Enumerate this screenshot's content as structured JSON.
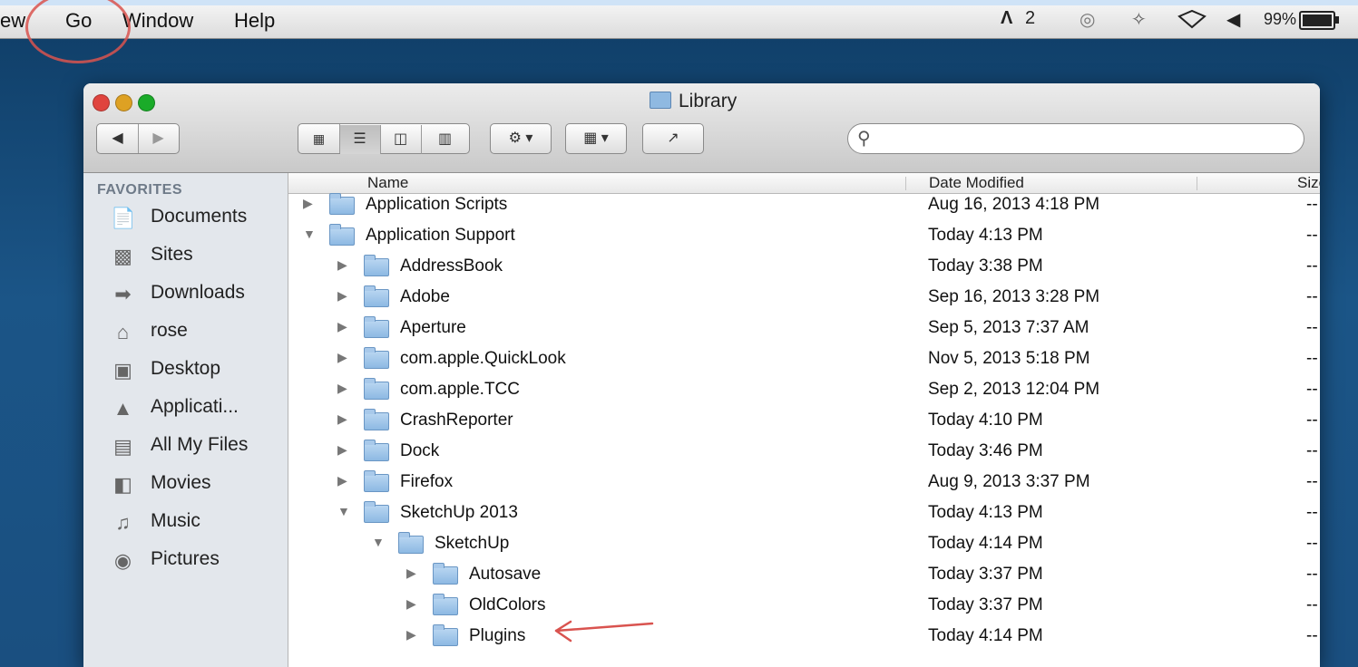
{
  "menubar": {
    "items": [
      "ew",
      "Go",
      "Window",
      "Help"
    ],
    "status": {
      "adobe": "2",
      "battery": "99%",
      "battery_level": 0.99
    },
    "icons": [
      "adobe-icon",
      "sync-icon",
      "bluetooth-icon",
      "wifi-icon",
      "volume-icon",
      "battery-icon"
    ],
    "highlight_color": "#d9534f"
  },
  "window": {
    "title": "Library",
    "search_placeholder": ""
  },
  "sidebar": {
    "heading": "FAVORITES",
    "items": [
      {
        "label": "Documents",
        "icon": "documents-icon"
      },
      {
        "label": "Sites",
        "icon": "folder-icon"
      },
      {
        "label": "Downloads",
        "icon": "downloads-icon"
      },
      {
        "label": "rose",
        "icon": "home-icon"
      },
      {
        "label": "Desktop",
        "icon": "desktop-icon"
      },
      {
        "label": "Applicati...",
        "icon": "applications-icon"
      },
      {
        "label": "All My Files",
        "icon": "all-files-icon"
      },
      {
        "label": "Movies",
        "icon": "movies-icon"
      },
      {
        "label": "Music",
        "icon": "music-icon"
      },
      {
        "label": "Pictures",
        "icon": "pictures-icon"
      }
    ]
  },
  "list": {
    "columns": {
      "name": "Name",
      "date": "Date Modified",
      "size": "Size"
    },
    "rows": [
      {
        "name": "Application Scripts",
        "date": "Aug 16, 2013 4:18 PM",
        "size": "--",
        "expanded": false,
        "depth": 0
      },
      {
        "name": "Application Support",
        "date": "Today 4:13 PM",
        "size": "--",
        "expanded": true,
        "depth": 0
      },
      {
        "name": "AddressBook",
        "date": "Today 3:38 PM",
        "size": "--",
        "expanded": false,
        "depth": 1
      },
      {
        "name": "Adobe",
        "date": "Sep 16, 2013 3:28 PM",
        "size": "--",
        "expanded": false,
        "depth": 1
      },
      {
        "name": "Aperture",
        "date": "Sep 5, 2013 7:37 AM",
        "size": "--",
        "expanded": false,
        "depth": 1
      },
      {
        "name": "com.apple.QuickLook",
        "date": "Nov 5, 2013 5:18 PM",
        "size": "--",
        "expanded": false,
        "depth": 1
      },
      {
        "name": "com.apple.TCC",
        "date": "Sep 2, 2013 12:04 PM",
        "size": "--",
        "expanded": false,
        "depth": 1
      },
      {
        "name": "CrashReporter",
        "date": "Today 4:10 PM",
        "size": "--",
        "expanded": false,
        "depth": 1
      },
      {
        "name": "Dock",
        "date": "Today 3:46 PM",
        "size": "--",
        "expanded": false,
        "depth": 1
      },
      {
        "name": "Firefox",
        "date": "Aug 9, 2013 3:37 PM",
        "size": "--",
        "expanded": false,
        "depth": 1
      },
      {
        "name": "SketchUp 2013",
        "date": "Today 4:13 PM",
        "size": "--",
        "expanded": true,
        "depth": 1
      },
      {
        "name": "SketchUp",
        "date": "Today 4:14 PM",
        "size": "--",
        "expanded": true,
        "depth": 2
      },
      {
        "name": "Autosave",
        "date": "Today 3:37 PM",
        "size": "--",
        "expanded": false,
        "depth": 3
      },
      {
        "name": "OldColors",
        "date": "Today 3:37 PM",
        "size": "--",
        "expanded": false,
        "depth": 3
      },
      {
        "name": "Plugins",
        "date": "Today 4:14 PM",
        "size": "--",
        "expanded": false,
        "depth": 3
      }
    ],
    "annotation_color": "#d9534f"
  }
}
